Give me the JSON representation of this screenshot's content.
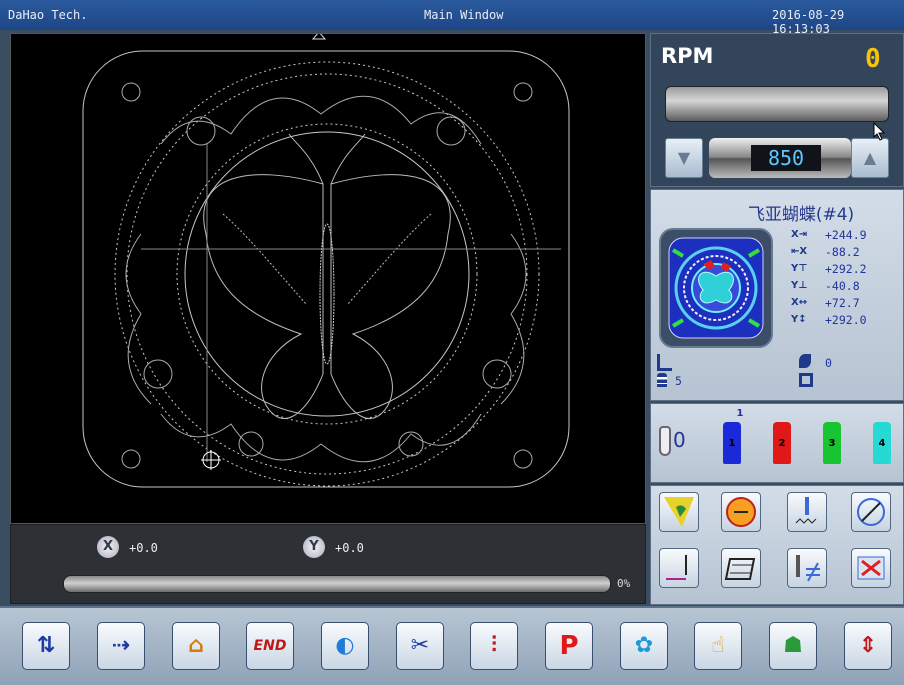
{
  "titlebar": {
    "left": "DaHao Tech.",
    "center": "Main Window",
    "right": "2016-08-29 16:13:03"
  },
  "coords": {
    "x_icon": "X",
    "x_value": "+0.0",
    "y_icon": "Y",
    "y_value": "+0.0",
    "progress_percent": "0%",
    "progress": 0
  },
  "rpm": {
    "label": "RPM",
    "value": "0",
    "speed_setting": "850",
    "down_arrow": "▼",
    "up_arrow": "▲"
  },
  "design": {
    "name": "飞亚蝴蝶(#4)",
    "stats": [
      {
        "icon": "X⇥",
        "value": "+244.9"
      },
      {
        "icon": "⇤X",
        "value": "-88.2"
      },
      {
        "icon": "Y⊤",
        "value": "+292.2"
      },
      {
        "icon": "Y⊥",
        "value": "-40.8"
      },
      {
        "icon": "X↔",
        "value": "+72.7"
      },
      {
        "icon": "Y↕",
        "value": "+292.0"
      }
    ],
    "bottom_left_value": "5",
    "bottom_right_value": "0"
  },
  "needles": {
    "current": "0",
    "active_marker": "1",
    "spools": [
      {
        "num": "1",
        "color": "#1b2ad8"
      },
      {
        "num": "2",
        "color": "#e01818"
      },
      {
        "num": "3",
        "color": "#19c431"
      },
      {
        "num": "4",
        "color": "#26d9d4"
      }
    ]
  },
  "toolbar": {
    "buttons": [
      {
        "name": "needle-set-icon",
        "glyph": "⇅"
      },
      {
        "name": "stitch-icon",
        "glyph": "⇢"
      },
      {
        "name": "home-icon",
        "glyph": "⌂"
      },
      {
        "name": "end-icon",
        "glyph": "END"
      },
      {
        "name": "frame-icon",
        "glyph": "◐"
      },
      {
        "name": "trim-icon",
        "glyph": "✂"
      },
      {
        "name": "needles-icon",
        "glyph": "⫶"
      },
      {
        "name": "parameter-icon",
        "glyph": "P"
      },
      {
        "name": "pattern-icon",
        "glyph": "✿"
      },
      {
        "name": "hand-icon",
        "glyph": "☝"
      },
      {
        "name": "user-icon",
        "glyph": "☗"
      },
      {
        "name": "direction-icon",
        "glyph": "⇕"
      }
    ]
  },
  "colors": {
    "accent_yellow": "#f6c40a",
    "speed_blue": "#5fc6ff",
    "design_blue": "#22339a"
  }
}
